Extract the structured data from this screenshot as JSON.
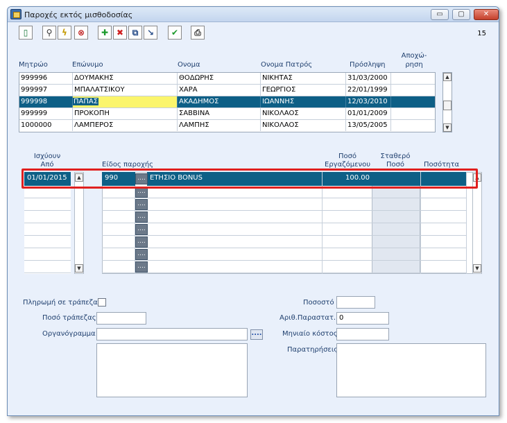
{
  "window": {
    "title": "Παροχές εκτός μισθοδοσίας",
    "page_number": "15",
    "controls": {
      "minimize": "▭",
      "maximize": "▢",
      "close": "✕"
    }
  },
  "toolbar": {
    "items": [
      {
        "name": "exit-icon",
        "glyph": "▯",
        "color": "#1a7a3a"
      },
      {
        "name": "search-icon",
        "glyph": "⚲",
        "color": "#333333"
      },
      {
        "name": "lightning-icon",
        "glyph": "ϟ",
        "color": "#c49a00"
      },
      {
        "name": "cancel-icon",
        "glyph": "⊗",
        "color": "#c02020"
      },
      {
        "name": "add-icon",
        "glyph": "✚",
        "color": "#1c9a2c"
      },
      {
        "name": "delete-icon",
        "glyph": "✖",
        "color": "#d02020"
      },
      {
        "name": "copy-icon",
        "glyph": "⧉",
        "color": "#2a4f8a"
      },
      {
        "name": "transfer-icon",
        "glyph": "↘",
        "color": "#2a4f8a"
      },
      {
        "name": "confirm-icon",
        "glyph": "✔",
        "color": "#1c9a2c"
      },
      {
        "name": "print-icon",
        "glyph": "⎙",
        "color": "#333333"
      }
    ]
  },
  "employees": {
    "headers": {
      "code": "Μητρώο",
      "surname": "Επώνυμο",
      "name": "Ονομα",
      "father": "Ονομα Πατρός",
      "hire": "Πρόσληψη",
      "leave_l1": "Αποχώ-",
      "leave_l2": "ρηση"
    },
    "rows": [
      {
        "code": "999996",
        "surname": "ΔΟΥΜΑΚΗΣ",
        "name": "ΘΟΔΩΡΗΣ",
        "father": "ΝΙΚΗΤΑΣ",
        "hire": "31/03/2000",
        "leave": "",
        "selected": false
      },
      {
        "code": "999997",
        "surname": "ΜΠΑΛΑΤΣΙΚΟΥ",
        "name": "ΧΑΡΑ",
        "father": "ΓΕΩΡΓΙΟΣ",
        "hire": "22/01/1999",
        "leave": "",
        "selected": false
      },
      {
        "code": "999998",
        "surname": "ΠΑΠΑΣ",
        "name": "ΑΚΑΔΗΜΟΣ",
        "father": "ΙΩΑΝΝΗΣ",
        "hire": "12/03/2010",
        "leave": "",
        "selected": true
      },
      {
        "code": "999999",
        "surname": "ΠΡΟΚΟΠΗ",
        "name": "ΣΑΒΒΙΝΑ",
        "father": "ΝΙΚΟΛΑΟΣ",
        "hire": "01/01/2009",
        "leave": "",
        "selected": false
      },
      {
        "code": "1000000",
        "surname": "ΛΑΜΠΕΡΟΣ",
        "name": "ΛΑΜΠΗΣ",
        "father": "ΝΙΚΟΛΑΟΣ",
        "hire": "13/05/2005",
        "leave": "",
        "selected": false
      }
    ]
  },
  "benefits": {
    "headers": {
      "valid_l1": "Ισχύουν",
      "valid_l2": "Από",
      "type": "Είδος παροχής",
      "amount_l1": "Ποσό",
      "amount_l2": "Εργαζόμενου",
      "fixed_l1": "Σταθερό",
      "fixed_l2": "Ποσό",
      "percent": "Ποσότητα"
    },
    "rows": [
      {
        "valid_from": "01/01/2015",
        "code": "990",
        "description": "ΕΤΗΣΙΟ BONUS",
        "amount": "100.00",
        "fixed": "",
        "quantity": ""
      }
    ],
    "dots_label": "....",
    "empty_rows": 7
  },
  "form": {
    "bank_payment_label": "Πληρωμή σε τράπεζα",
    "bank_amount_label": "Ποσό τράπεζας",
    "bank_amount_value": "",
    "org_chart_label": "Οργανόγραμμα",
    "org_chart_value": "",
    "org_dots": "....",
    "percent_label": "Ποσοστό",
    "percent_value": "",
    "doc_count_label": "Αριθ.Παραστατ.",
    "doc_count_value": "0",
    "monthly_cost_label": "Μηνιαίο κόστος",
    "monthly_cost_value": "",
    "notes_label": "Παρατηρήσεις",
    "notes_value": ""
  },
  "colors": {
    "selection": "#0d5f86",
    "highlight": "#fbf56c",
    "callout": "#e0201f"
  }
}
